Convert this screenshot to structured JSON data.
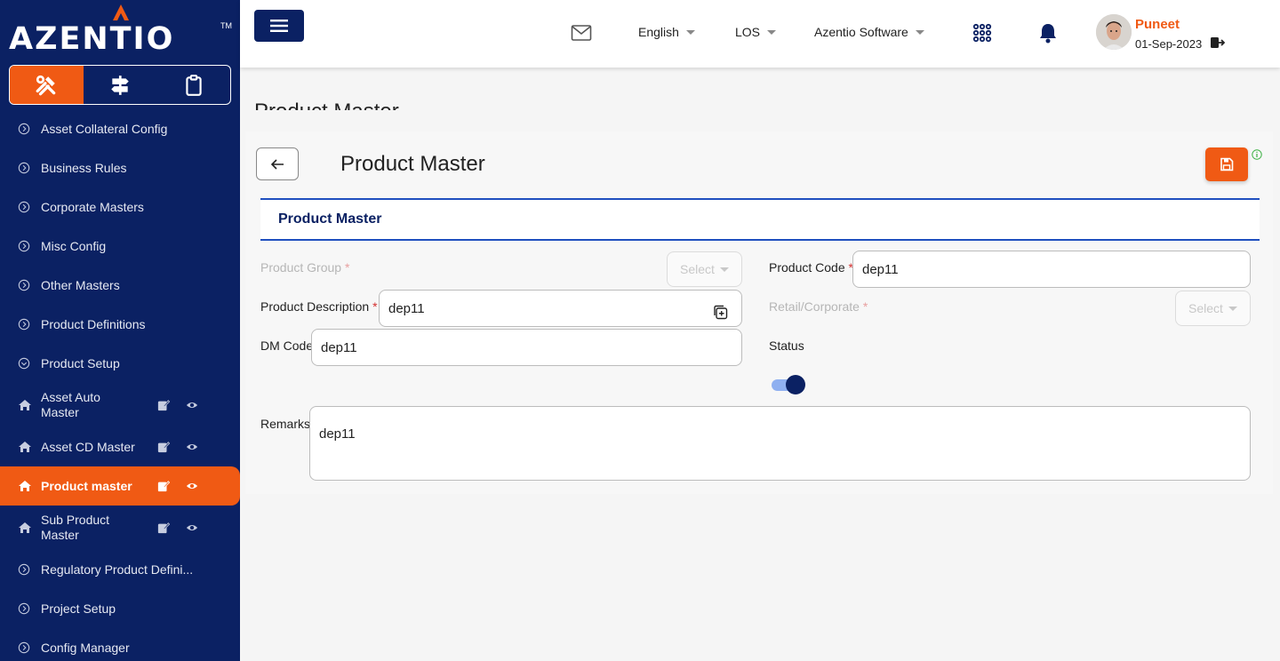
{
  "brand": {
    "name": "AZENTIO",
    "tm": "TM",
    "accent": "#f05a14",
    "navy": "#0b2163"
  },
  "sidebar": {
    "tabs": [
      {
        "icon": "tools-icon",
        "active": true
      },
      {
        "icon": "signpost-icon",
        "active": false
      },
      {
        "icon": "clipboard-icon",
        "active": false
      }
    ],
    "items": [
      {
        "label": "Asset Collateral Config",
        "icon": "circle-chevron-right-icon"
      },
      {
        "label": "Business Rules",
        "icon": "circle-chevron-right-icon"
      },
      {
        "label": "Corporate Masters",
        "icon": "circle-chevron-right-icon"
      },
      {
        "label": "Misc Config",
        "icon": "circle-chevron-right-icon"
      },
      {
        "label": "Other Masters",
        "icon": "circle-chevron-right-icon"
      },
      {
        "label": "Product Definitions",
        "icon": "circle-chevron-right-icon"
      },
      {
        "label": "Product Setup",
        "icon": "circle-chevron-down-icon"
      },
      {
        "label": "Asset Auto Master",
        "icon": "house-icon"
      },
      {
        "label": "Asset CD Master",
        "icon": "house-icon"
      },
      {
        "label": "Product master",
        "icon": "house-icon"
      },
      {
        "label": "Sub Product Master",
        "icon": "house-icon"
      },
      {
        "label": "Regulatory Product Defini...",
        "icon": "circle-chevron-right-icon"
      },
      {
        "label": "Project Setup",
        "icon": "circle-chevron-right-icon"
      },
      {
        "label": "Config Manager",
        "icon": "circle-chevron-right-icon"
      }
    ]
  },
  "topbar": {
    "language": "English",
    "module": "LOS",
    "company": "Azentio Software",
    "user": {
      "name": "Puneet",
      "date": "01-Sep-2023"
    }
  },
  "page": {
    "heading": "Product Master",
    "title": "Product Master",
    "section_title": "Product Master"
  },
  "form": {
    "product_group": {
      "label": "Product Group",
      "placeholder": "Select"
    },
    "product_code": {
      "label": "Product Code",
      "value": "dep11"
    },
    "product_description": {
      "label": "Product Description",
      "value": "dep11"
    },
    "retail_corporate": {
      "label": "Retail/Corporate",
      "placeholder": "Select"
    },
    "dm_code": {
      "label": "DM Code",
      "value": "dep11"
    },
    "status": {
      "label": "Status",
      "enabled": true
    },
    "remarks": {
      "label": "Remarks",
      "value": "dep11"
    },
    "required_marker": "*"
  }
}
